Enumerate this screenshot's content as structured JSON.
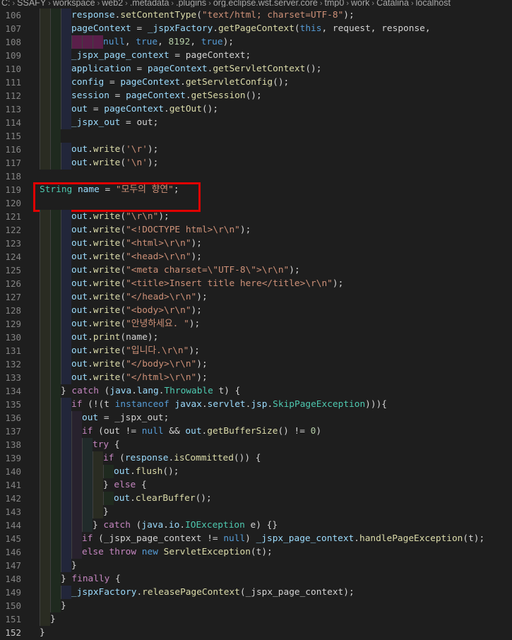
{
  "breadcrumb": [
    "C:",
    "SSAFY",
    "workspace",
    "web2",
    ".metadata",
    ".plugins",
    "org.eclipse.wst.server.core",
    "tmp0",
    "work",
    "Catalina",
    "localhost"
  ],
  "colors": {
    "background": "#1e1e1e",
    "keyword": "#569cd6",
    "control": "#c586c0",
    "type": "#4ec9b0",
    "function": "#dcdcaa",
    "variable": "#9cdcfe",
    "string": "#ce9178",
    "number": "#b5cea8",
    "highlight_box": "#e00000"
  },
  "editor": {
    "current_line": 152,
    "highlighted_line": 119,
    "lines": [
      {
        "n": 106,
        "indent": 3,
        "tokens": [
          [
            "v",
            "response"
          ],
          [
            "p",
            "."
          ],
          [
            "f",
            "setContentType"
          ],
          [
            "p",
            "("
          ],
          [
            "s",
            "\"text/html; charset=UTF-8\""
          ],
          [
            "p",
            ");"
          ]
        ]
      },
      {
        "n": 107,
        "indent": 3,
        "tokens": [
          [
            "v",
            "pageContext"
          ],
          [
            "p",
            " = "
          ],
          [
            "v",
            "_jspxFactory"
          ],
          [
            "p",
            "."
          ],
          [
            "f",
            "getPageContext"
          ],
          [
            "p",
            "("
          ],
          [
            "k",
            "this"
          ],
          [
            "p",
            ", request, response,"
          ]
        ]
      },
      {
        "n": 108,
        "indent": 6,
        "bad": true,
        "tokens": [
          [
            "k",
            "null"
          ],
          [
            "p",
            ", "
          ],
          [
            "k",
            "true"
          ],
          [
            "p",
            ", "
          ],
          [
            "n",
            "8192"
          ],
          [
            "p",
            ", "
          ],
          [
            "k",
            "true"
          ],
          [
            "p",
            ");"
          ]
        ]
      },
      {
        "n": 109,
        "indent": 3,
        "tokens": [
          [
            "v",
            "_jspx_page_context"
          ],
          [
            "p",
            " = pageContext;"
          ]
        ]
      },
      {
        "n": 110,
        "indent": 3,
        "tokens": [
          [
            "v",
            "application"
          ],
          [
            "p",
            " = "
          ],
          [
            "v",
            "pageContext"
          ],
          [
            "p",
            "."
          ],
          [
            "f",
            "getServletContext"
          ],
          [
            "p",
            "();"
          ]
        ]
      },
      {
        "n": 111,
        "indent": 3,
        "tokens": [
          [
            "v",
            "config"
          ],
          [
            "p",
            " = "
          ],
          [
            "v",
            "pageContext"
          ],
          [
            "p",
            "."
          ],
          [
            "f",
            "getServletConfig"
          ],
          [
            "p",
            "();"
          ]
        ]
      },
      {
        "n": 112,
        "indent": 3,
        "tokens": [
          [
            "v",
            "session"
          ],
          [
            "p",
            " = "
          ],
          [
            "v",
            "pageContext"
          ],
          [
            "p",
            "."
          ],
          [
            "f",
            "getSession"
          ],
          [
            "p",
            "();"
          ]
        ]
      },
      {
        "n": 113,
        "indent": 3,
        "tokens": [
          [
            "v",
            "out"
          ],
          [
            "p",
            " = "
          ],
          [
            "v",
            "pageContext"
          ],
          [
            "p",
            "."
          ],
          [
            "f",
            "getOut"
          ],
          [
            "p",
            "();"
          ]
        ]
      },
      {
        "n": 114,
        "indent": 3,
        "tokens": [
          [
            "v",
            "_jspx_out"
          ],
          [
            "p",
            " = out;"
          ]
        ]
      },
      {
        "n": 115,
        "indent": 2,
        "tokens": []
      },
      {
        "n": 116,
        "indent": 3,
        "tokens": [
          [
            "v",
            "out"
          ],
          [
            "p",
            "."
          ],
          [
            "f",
            "write"
          ],
          [
            "p",
            "("
          ],
          [
            "s",
            "'\\r'"
          ],
          [
            "p",
            ");"
          ]
        ]
      },
      {
        "n": 117,
        "indent": 3,
        "tokens": [
          [
            "v",
            "out"
          ],
          [
            "p",
            "."
          ],
          [
            "f",
            "write"
          ],
          [
            "p",
            "("
          ],
          [
            "s",
            "'\\n'"
          ],
          [
            "p",
            ");"
          ]
        ]
      },
      {
        "n": 118,
        "indent": 0,
        "tokens": []
      },
      {
        "n": 119,
        "indent": 0,
        "tokens": [
          [
            "t",
            "String"
          ],
          [
            "p",
            " "
          ],
          [
            "v",
            "name"
          ],
          [
            "p",
            " = "
          ],
          [
            "s",
            "\"모두의 향연\""
          ],
          [
            "p",
            ";"
          ]
        ]
      },
      {
        "n": 120,
        "indent": 0,
        "tokens": []
      },
      {
        "n": 121,
        "indent": 3,
        "tokens": [
          [
            "v",
            "out"
          ],
          [
            "p",
            "."
          ],
          [
            "f",
            "write"
          ],
          [
            "p",
            "("
          ],
          [
            "s",
            "\"\\r\\n\""
          ],
          [
            "p",
            ");"
          ]
        ]
      },
      {
        "n": 122,
        "indent": 3,
        "tokens": [
          [
            "v",
            "out"
          ],
          [
            "p",
            "."
          ],
          [
            "f",
            "write"
          ],
          [
            "p",
            "("
          ],
          [
            "s",
            "\"<!DOCTYPE html>\\r\\n\""
          ],
          [
            "p",
            ");"
          ]
        ]
      },
      {
        "n": 123,
        "indent": 3,
        "tokens": [
          [
            "v",
            "out"
          ],
          [
            "p",
            "."
          ],
          [
            "f",
            "write"
          ],
          [
            "p",
            "("
          ],
          [
            "s",
            "\"<html>\\r\\n\""
          ],
          [
            "p",
            ");"
          ]
        ]
      },
      {
        "n": 124,
        "indent": 3,
        "tokens": [
          [
            "v",
            "out"
          ],
          [
            "p",
            "."
          ],
          [
            "f",
            "write"
          ],
          [
            "p",
            "("
          ],
          [
            "s",
            "\"<head>\\r\\n\""
          ],
          [
            "p",
            ");"
          ]
        ]
      },
      {
        "n": 125,
        "indent": 3,
        "tokens": [
          [
            "v",
            "out"
          ],
          [
            "p",
            "."
          ],
          [
            "f",
            "write"
          ],
          [
            "p",
            "("
          ],
          [
            "s",
            "\"<meta charset=\\\"UTF-8\\\">\\r\\n\""
          ],
          [
            "p",
            ");"
          ]
        ]
      },
      {
        "n": 126,
        "indent": 3,
        "tokens": [
          [
            "v",
            "out"
          ],
          [
            "p",
            "."
          ],
          [
            "f",
            "write"
          ],
          [
            "p",
            "("
          ],
          [
            "s",
            "\"<title>Insert title here</title>\\r\\n\""
          ],
          [
            "p",
            ");"
          ]
        ]
      },
      {
        "n": 127,
        "indent": 3,
        "tokens": [
          [
            "v",
            "out"
          ],
          [
            "p",
            "."
          ],
          [
            "f",
            "write"
          ],
          [
            "p",
            "("
          ],
          [
            "s",
            "\"</head>\\r\\n\""
          ],
          [
            "p",
            ");"
          ]
        ]
      },
      {
        "n": 128,
        "indent": 3,
        "tokens": [
          [
            "v",
            "out"
          ],
          [
            "p",
            "."
          ],
          [
            "f",
            "write"
          ],
          [
            "p",
            "("
          ],
          [
            "s",
            "\"<body>\\r\\n\""
          ],
          [
            "p",
            ");"
          ]
        ]
      },
      {
        "n": 129,
        "indent": 3,
        "tokens": [
          [
            "v",
            "out"
          ],
          [
            "p",
            "."
          ],
          [
            "f",
            "write"
          ],
          [
            "p",
            "("
          ],
          [
            "s",
            "\"안녕하세요. \""
          ],
          [
            "p",
            ");"
          ]
        ]
      },
      {
        "n": 130,
        "indent": 3,
        "tokens": [
          [
            "v",
            "out"
          ],
          [
            "p",
            "."
          ],
          [
            "f",
            "print"
          ],
          [
            "p",
            "(name);"
          ]
        ]
      },
      {
        "n": 131,
        "indent": 3,
        "tokens": [
          [
            "v",
            "out"
          ],
          [
            "p",
            "."
          ],
          [
            "f",
            "write"
          ],
          [
            "p",
            "("
          ],
          [
            "s",
            "\"입니다.\\r\\n\""
          ],
          [
            "p",
            ");"
          ]
        ]
      },
      {
        "n": 132,
        "indent": 3,
        "tokens": [
          [
            "v",
            "out"
          ],
          [
            "p",
            "."
          ],
          [
            "f",
            "write"
          ],
          [
            "p",
            "("
          ],
          [
            "s",
            "\"</body>\\r\\n\""
          ],
          [
            "p",
            ");"
          ]
        ]
      },
      {
        "n": 133,
        "indent": 3,
        "tokens": [
          [
            "v",
            "out"
          ],
          [
            "p",
            "."
          ],
          [
            "f",
            "write"
          ],
          [
            "p",
            "("
          ],
          [
            "s",
            "\"</html>\\r\\n\""
          ],
          [
            "p",
            ");"
          ]
        ]
      },
      {
        "n": 134,
        "indent": 2,
        "tokens": [
          [
            "p",
            "} "
          ],
          [
            "c",
            "catch"
          ],
          [
            "p",
            " ("
          ],
          [
            "v",
            "java"
          ],
          [
            "p",
            "."
          ],
          [
            "v",
            "lang"
          ],
          [
            "p",
            "."
          ],
          [
            "t",
            "Throwable"
          ],
          [
            "p",
            " t) {"
          ]
        ]
      },
      {
        "n": 135,
        "indent": 3,
        "tokens": [
          [
            "c",
            "if"
          ],
          [
            "p",
            " (!(t "
          ],
          [
            "k",
            "instanceof"
          ],
          [
            "p",
            " "
          ],
          [
            "v",
            "javax"
          ],
          [
            "p",
            "."
          ],
          [
            "v",
            "servlet"
          ],
          [
            "p",
            "."
          ],
          [
            "v",
            "jsp"
          ],
          [
            "p",
            "."
          ],
          [
            "t",
            "SkipPageException"
          ],
          [
            "p",
            "))){"
          ]
        ]
      },
      {
        "n": 136,
        "indent": 4,
        "tokens": [
          [
            "v",
            "out"
          ],
          [
            "p",
            " = _jspx_out;"
          ]
        ]
      },
      {
        "n": 137,
        "indent": 4,
        "tokens": [
          [
            "c",
            "if"
          ],
          [
            "p",
            " (out != "
          ],
          [
            "k",
            "null"
          ],
          [
            "p",
            " && "
          ],
          [
            "v",
            "out"
          ],
          [
            "p",
            "."
          ],
          [
            "f",
            "getBufferSize"
          ],
          [
            "p",
            "() != "
          ],
          [
            "n",
            "0"
          ],
          [
            "p",
            ")"
          ]
        ]
      },
      {
        "n": 138,
        "indent": 5,
        "tokens": [
          [
            "c",
            "try"
          ],
          [
            "p",
            " {"
          ]
        ]
      },
      {
        "n": 139,
        "indent": 6,
        "tokens": [
          [
            "c",
            "if"
          ],
          [
            "p",
            " ("
          ],
          [
            "v",
            "response"
          ],
          [
            "p",
            "."
          ],
          [
            "f",
            "isCommitted"
          ],
          [
            "p",
            "()) {"
          ]
        ]
      },
      {
        "n": 140,
        "indent": 7,
        "tokens": [
          [
            "v",
            "out"
          ],
          [
            "p",
            "."
          ],
          [
            "f",
            "flush"
          ],
          [
            "p",
            "();"
          ]
        ]
      },
      {
        "n": 141,
        "indent": 6,
        "tokens": [
          [
            "p",
            "} "
          ],
          [
            "c",
            "else"
          ],
          [
            "p",
            " {"
          ]
        ]
      },
      {
        "n": 142,
        "indent": 7,
        "tokens": [
          [
            "v",
            "out"
          ],
          [
            "p",
            "."
          ],
          [
            "f",
            "clearBuffer"
          ],
          [
            "p",
            "();"
          ]
        ]
      },
      {
        "n": 143,
        "indent": 6,
        "tokens": [
          [
            "p",
            "}"
          ]
        ]
      },
      {
        "n": 144,
        "indent": 5,
        "tokens": [
          [
            "p",
            "} "
          ],
          [
            "c",
            "catch"
          ],
          [
            "p",
            " ("
          ],
          [
            "v",
            "java"
          ],
          [
            "p",
            "."
          ],
          [
            "v",
            "io"
          ],
          [
            "p",
            "."
          ],
          [
            "t",
            "IOException"
          ],
          [
            "p",
            " e) {}"
          ]
        ]
      },
      {
        "n": 145,
        "indent": 4,
        "tokens": [
          [
            "c",
            "if"
          ],
          [
            "p",
            " (_jspx_page_context != "
          ],
          [
            "k",
            "null"
          ],
          [
            "p",
            ") "
          ],
          [
            "v",
            "_jspx_page_context"
          ],
          [
            "p",
            "."
          ],
          [
            "f",
            "handlePageException"
          ],
          [
            "p",
            "(t);"
          ]
        ]
      },
      {
        "n": 146,
        "indent": 4,
        "tokens": [
          [
            "c",
            "else"
          ],
          [
            "p",
            " "
          ],
          [
            "c",
            "throw"
          ],
          [
            "p",
            " "
          ],
          [
            "k",
            "new"
          ],
          [
            "p",
            " "
          ],
          [
            "f",
            "ServletException"
          ],
          [
            "p",
            "(t);"
          ]
        ]
      },
      {
        "n": 147,
        "indent": 3,
        "tokens": [
          [
            "p",
            "}"
          ]
        ]
      },
      {
        "n": 148,
        "indent": 2,
        "tokens": [
          [
            "p",
            "} "
          ],
          [
            "c",
            "finally"
          ],
          [
            "p",
            " {"
          ]
        ]
      },
      {
        "n": 149,
        "indent": 3,
        "tokens": [
          [
            "v",
            "_jspxFactory"
          ],
          [
            "p",
            "."
          ],
          [
            "f",
            "releasePageContext"
          ],
          [
            "p",
            "(_jspx_page_context);"
          ]
        ]
      },
      {
        "n": 150,
        "indent": 2,
        "tokens": [
          [
            "p",
            "}"
          ]
        ]
      },
      {
        "n": 151,
        "indent": 1,
        "tokens": [
          [
            "p",
            "}"
          ]
        ]
      },
      {
        "n": 152,
        "indent": 0,
        "tokens": [
          [
            "p",
            "}"
          ]
        ]
      }
    ]
  }
}
